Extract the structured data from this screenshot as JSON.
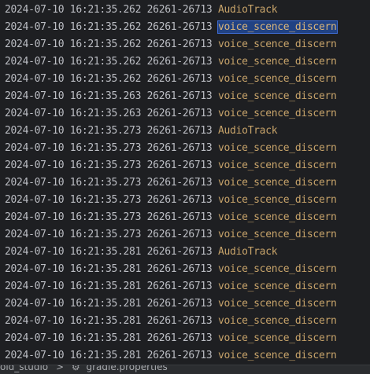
{
  "log": {
    "rows": [
      {
        "timestamp": "2024-07-10 16:21:35.262",
        "pid_tid": "26261-26713",
        "tag": "AudioTrack"
      },
      {
        "timestamp": "2024-07-10 16:21:35.262",
        "pid_tid": "26261-26713",
        "tag": "voice_scence_discern"
      },
      {
        "timestamp": "2024-07-10 16:21:35.262",
        "pid_tid": "26261-26713",
        "tag": "voice_scence_discern"
      },
      {
        "timestamp": "2024-07-10 16:21:35.262",
        "pid_tid": "26261-26713",
        "tag": "voice_scence_discern"
      },
      {
        "timestamp": "2024-07-10 16:21:35.262",
        "pid_tid": "26261-26713",
        "tag": "voice_scence_discern"
      },
      {
        "timestamp": "2024-07-10 16:21:35.263",
        "pid_tid": "26261-26713",
        "tag": "voice_scence_discern"
      },
      {
        "timestamp": "2024-07-10 16:21:35.263",
        "pid_tid": "26261-26713",
        "tag": "voice_scence_discern"
      },
      {
        "timestamp": "2024-07-10 16:21:35.273",
        "pid_tid": "26261-26713",
        "tag": "AudioTrack"
      },
      {
        "timestamp": "2024-07-10 16:21:35.273",
        "pid_tid": "26261-26713",
        "tag": "voice_scence_discern"
      },
      {
        "timestamp": "2024-07-10 16:21:35.273",
        "pid_tid": "26261-26713",
        "tag": "voice_scence_discern"
      },
      {
        "timestamp": "2024-07-10 16:21:35.273",
        "pid_tid": "26261-26713",
        "tag": "voice_scence_discern"
      },
      {
        "timestamp": "2024-07-10 16:21:35.273",
        "pid_tid": "26261-26713",
        "tag": "voice_scence_discern"
      },
      {
        "timestamp": "2024-07-10 16:21:35.273",
        "pid_tid": "26261-26713",
        "tag": "voice_scence_discern"
      },
      {
        "timestamp": "2024-07-10 16:21:35.273",
        "pid_tid": "26261-26713",
        "tag": "voice_scence_discern"
      },
      {
        "timestamp": "2024-07-10 16:21:35.281",
        "pid_tid": "26261-26713",
        "tag": "AudioTrack"
      },
      {
        "timestamp": "2024-07-10 16:21:35.281",
        "pid_tid": "26261-26713",
        "tag": "voice_scence_discern"
      },
      {
        "timestamp": "2024-07-10 16:21:35.281",
        "pid_tid": "26261-26713",
        "tag": "voice_scence_discern"
      },
      {
        "timestamp": "2024-07-10 16:21:35.281",
        "pid_tid": "26261-26713",
        "tag": "voice_scence_discern"
      },
      {
        "timestamp": "2024-07-10 16:21:35.281",
        "pid_tid": "26261-26713",
        "tag": "voice_scence_discern"
      },
      {
        "timestamp": "2024-07-10 16:21:35.281",
        "pid_tid": "26261-26713",
        "tag": "voice_scence_discern"
      },
      {
        "timestamp": "2024-07-10 16:21:35.281",
        "pid_tid": "26261-26713",
        "tag": "voice_scence_discern"
      }
    ],
    "selected_row": 1
  },
  "statusbar": {
    "crumb_project": "oid_studio",
    "crumb_separator": ">",
    "crumb_file": "gradle.properties",
    "file_icon": "gear-icon"
  },
  "colors": {
    "background": "#1e1f22",
    "text": "#bcbec4",
    "tag": "#c7a36a",
    "selection": "#214283"
  }
}
